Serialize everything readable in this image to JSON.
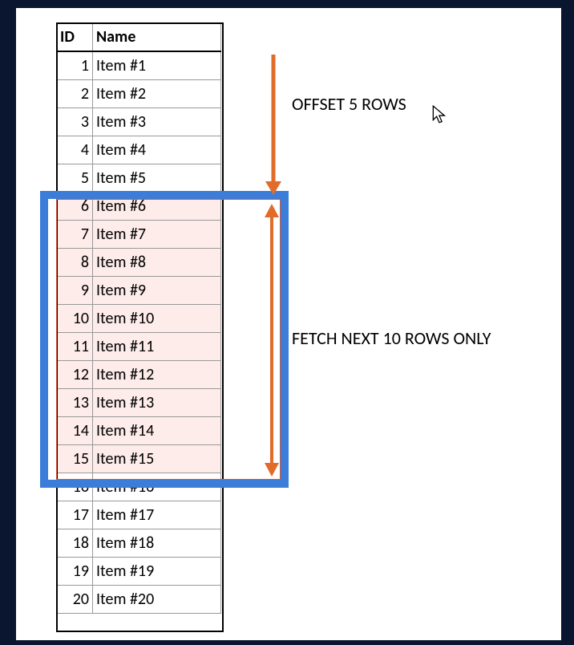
{
  "colors": {
    "highlight_box": "#3b7dd8",
    "arrow": "#e26b2a",
    "pink_fill": "#fdecea"
  },
  "table": {
    "headers": {
      "id": "ID",
      "name": "Name"
    },
    "rows": [
      {
        "id": "1",
        "name": "Item #1"
      },
      {
        "id": "2",
        "name": "Item #2"
      },
      {
        "id": "3",
        "name": "Item #3"
      },
      {
        "id": "4",
        "name": "Item #4"
      },
      {
        "id": "5",
        "name": "Item #5"
      },
      {
        "id": "6",
        "name": "Item #6"
      },
      {
        "id": "7",
        "name": "Item #7"
      },
      {
        "id": "8",
        "name": "Item #8"
      },
      {
        "id": "9",
        "name": "Item #9"
      },
      {
        "id": "10",
        "name": "Item #10"
      },
      {
        "id": "11",
        "name": "Item #11"
      },
      {
        "id": "12",
        "name": "Item #12"
      },
      {
        "id": "13",
        "name": "Item #13"
      },
      {
        "id": "14",
        "name": "Item #14"
      },
      {
        "id": "15",
        "name": "Item #15"
      },
      {
        "id": "16",
        "name": "Item #16"
      },
      {
        "id": "17",
        "name": "Item #17"
      },
      {
        "id": "18",
        "name": "Item #18"
      },
      {
        "id": "19",
        "name": "Item #19"
      },
      {
        "id": "20",
        "name": "Item #20"
      }
    ],
    "highlight_range": {
      "start_index": 5,
      "end_index": 14
    }
  },
  "annotations": {
    "offset": "OFFSET 5 ROWS",
    "fetch": "FETCH NEXT 10 ROWS ONLY"
  }
}
